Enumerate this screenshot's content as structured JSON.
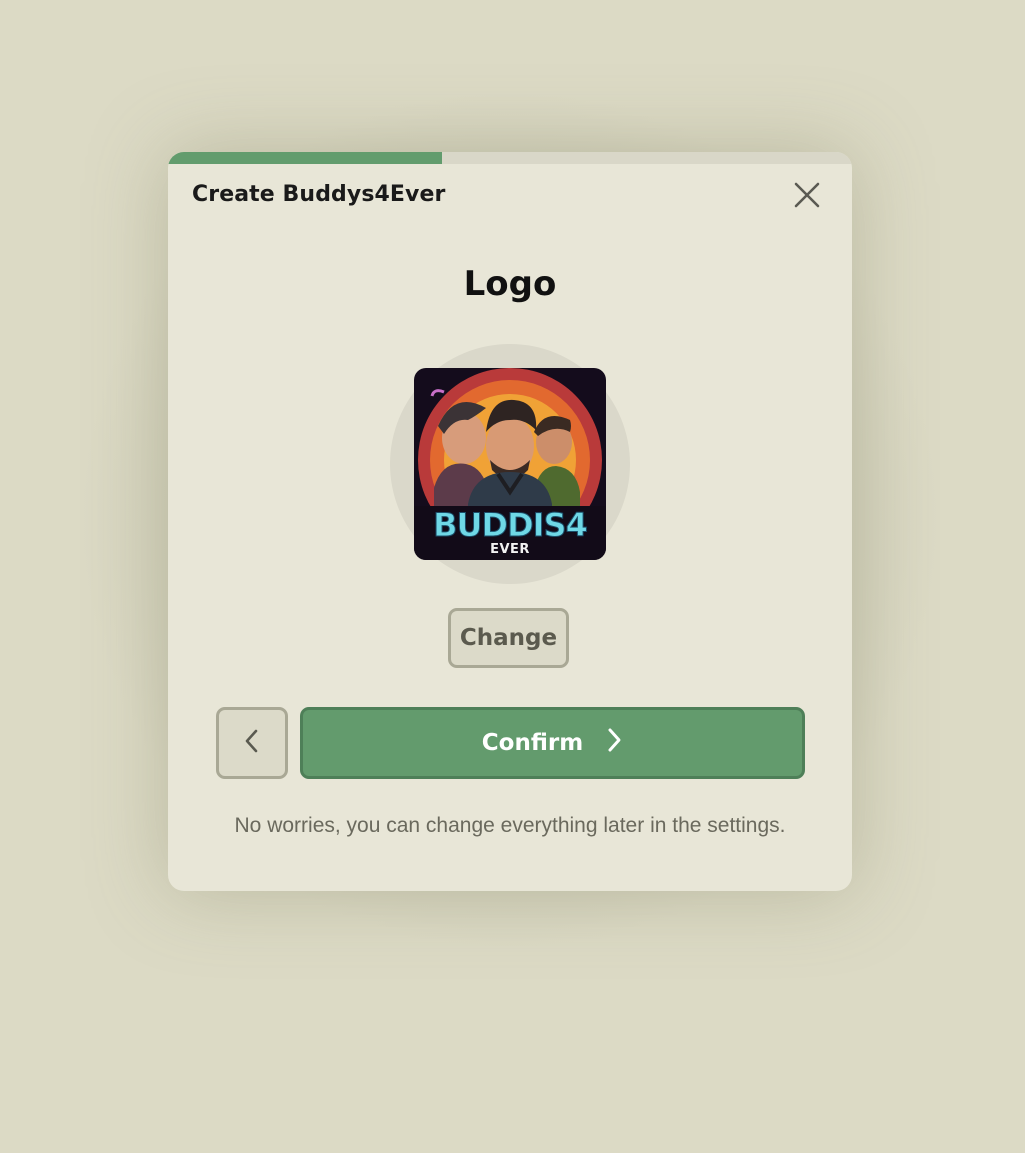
{
  "dialog": {
    "title": "Create Buddys4Ever",
    "progress": 0.4,
    "section_heading": "Logo",
    "logo": {
      "text_main": "BUDDIS4",
      "text_sub": "EVER"
    },
    "change_label": "Change",
    "confirm_label": "Confirm",
    "footnote": "No worries, you can change everything later in the settings.",
    "icons": {
      "close": "close-icon",
      "back": "chevron-left-icon",
      "forward": "chevron-right-icon"
    },
    "colors": {
      "accent": "#629c6d",
      "modal_bg": "#e8e6d7",
      "page_bg": "#dcdac5"
    }
  }
}
